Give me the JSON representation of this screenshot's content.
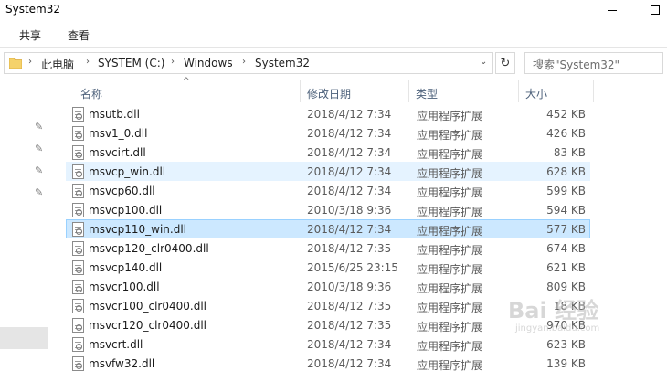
{
  "window": {
    "title": "System32",
    "minimize_icon": "minimize-icon",
    "maximize_icon": "maximize-icon"
  },
  "ribbon": {
    "tabs": [
      {
        "label": "共享"
      },
      {
        "label": "查看"
      }
    ]
  },
  "address": {
    "breadcrumb": [
      "此电脑",
      "SYSTEM (C:)",
      "Windows",
      "System32"
    ],
    "separator": "›",
    "dropdown_glyph": "⌄",
    "refresh_glyph": "↻",
    "search_placeholder": "搜索\"System32\""
  },
  "navpane": {
    "pin_glyph": "✎"
  },
  "columns": {
    "name": "名称",
    "date": "修改日期",
    "type": "类型",
    "size": "大小",
    "sort_glyph": "^"
  },
  "files": [
    {
      "name": "msutb.dll",
      "date": "2018/4/12 7:34",
      "type": "应用程序扩展",
      "size": "452 KB",
      "state": "normal"
    },
    {
      "name": "msv1_0.dll",
      "date": "2018/4/12 7:34",
      "type": "应用程序扩展",
      "size": "426 KB",
      "state": "normal"
    },
    {
      "name": "msvcirt.dll",
      "date": "2018/4/12 7:34",
      "type": "应用程序扩展",
      "size": "83 KB",
      "state": "normal"
    },
    {
      "name": "msvcp_win.dll",
      "date": "2018/4/12 7:34",
      "type": "应用程序扩展",
      "size": "628 KB",
      "state": "hover"
    },
    {
      "name": "msvcp60.dll",
      "date": "2018/4/12 7:34",
      "type": "应用程序扩展",
      "size": "599 KB",
      "state": "normal"
    },
    {
      "name": "msvcp100.dll",
      "date": "2010/3/18 9:36",
      "type": "应用程序扩展",
      "size": "594 KB",
      "state": "normal"
    },
    {
      "name": "msvcp110_win.dll",
      "date": "2018/4/12 7:34",
      "type": "应用程序扩展",
      "size": "577 KB",
      "state": "selected"
    },
    {
      "name": "msvcp120_clr0400.dll",
      "date": "2018/4/12 7:35",
      "type": "应用程序扩展",
      "size": "674 KB",
      "state": "normal"
    },
    {
      "name": "msvcp140.dll",
      "date": "2015/6/25 23:15",
      "type": "应用程序扩展",
      "size": "621 KB",
      "state": "normal"
    },
    {
      "name": "msvcr100.dll",
      "date": "2010/3/18 9:36",
      "type": "应用程序扩展",
      "size": "809 KB",
      "state": "normal"
    },
    {
      "name": "msvcr100_clr0400.dll",
      "date": "2018/4/12 7:35",
      "type": "应用程序扩展",
      "size": "18 KB",
      "state": "normal"
    },
    {
      "name": "msvcr120_clr0400.dll",
      "date": "2018/4/12 7:35",
      "type": "应用程序扩展",
      "size": "970 KB",
      "state": "normal"
    },
    {
      "name": "msvcrt.dll",
      "date": "2018/4/12 7:34",
      "type": "应用程序扩展",
      "size": "623 KB",
      "state": "normal"
    },
    {
      "name": "msvfw32.dll",
      "date": "2018/4/12 7:34",
      "type": "应用程序扩展",
      "size": "139 KB",
      "state": "normal"
    }
  ],
  "watermark": {
    "main": "Bai 经验",
    "sub": "jingyan.baidu.com"
  }
}
